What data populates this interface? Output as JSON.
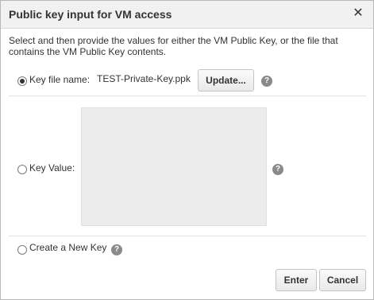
{
  "dialog": {
    "title": "Public key input for VM access",
    "close_symbol": "✕",
    "description": "Select and then provide the values for either the VM Public Key, or the file that contains the VM Public Key contents."
  },
  "options": {
    "key_file": {
      "label": "Key file name:",
      "filename": "TEST-Private-Key.ppk",
      "update_label": "Update...",
      "selected": true
    },
    "key_value": {
      "label": "Key Value:",
      "value": "",
      "selected": false
    },
    "new_key": {
      "label": "Create a New Key",
      "selected": false
    }
  },
  "help_icon_text": "?",
  "footer": {
    "enter_label": "Enter",
    "cancel_label": "Cancel"
  }
}
